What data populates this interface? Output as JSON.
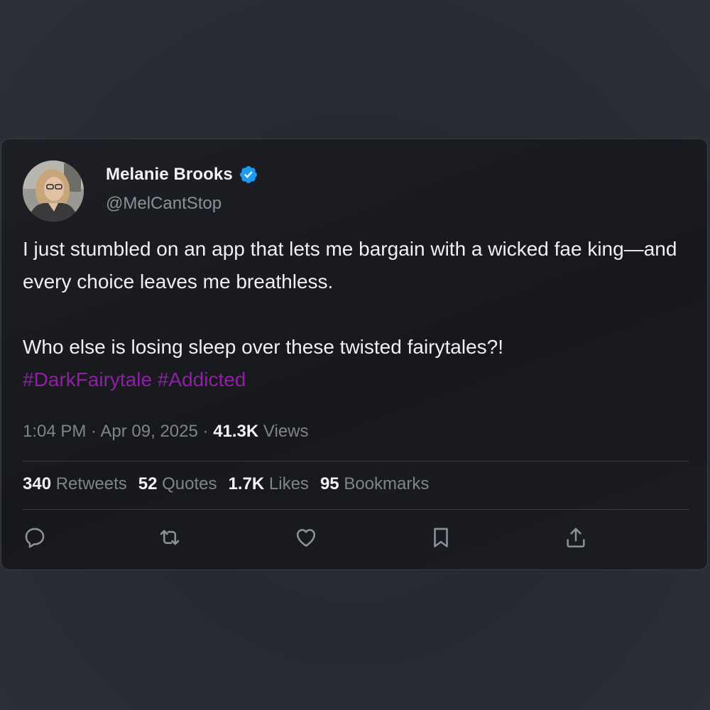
{
  "user": {
    "display_name": "Melanie Brooks",
    "handle": "@MelCantStop",
    "verified": true
  },
  "tweet": {
    "line1": "I just stumbled on an app that lets me bargain with a wicked fae king—and every choice leaves me breathless.",
    "line2": "Who else is losing sleep over these twisted fairytales?!",
    "hashtags": "#DarkFairytale #Addicted"
  },
  "meta": {
    "time": "1:04 PM",
    "date": "Apr 09, 2025",
    "views_count": "41.3K",
    "views_label": "Views"
  },
  "stats": {
    "retweets_count": "340",
    "retweets_label": "Retweets",
    "quotes_count": "52",
    "quotes_label": "Quotes",
    "likes_count": "1.7K",
    "likes_label": "Likes",
    "bookmarks_count": "95",
    "bookmarks_label": "Bookmarks"
  },
  "icons": {
    "reply": "reply-icon",
    "retweet": "retweet-icon",
    "like": "heart-icon",
    "bookmark": "bookmark-icon",
    "share": "share-icon"
  },
  "colors": {
    "hashtag": "#8f1fa6",
    "verified": "#1d9bf0"
  }
}
